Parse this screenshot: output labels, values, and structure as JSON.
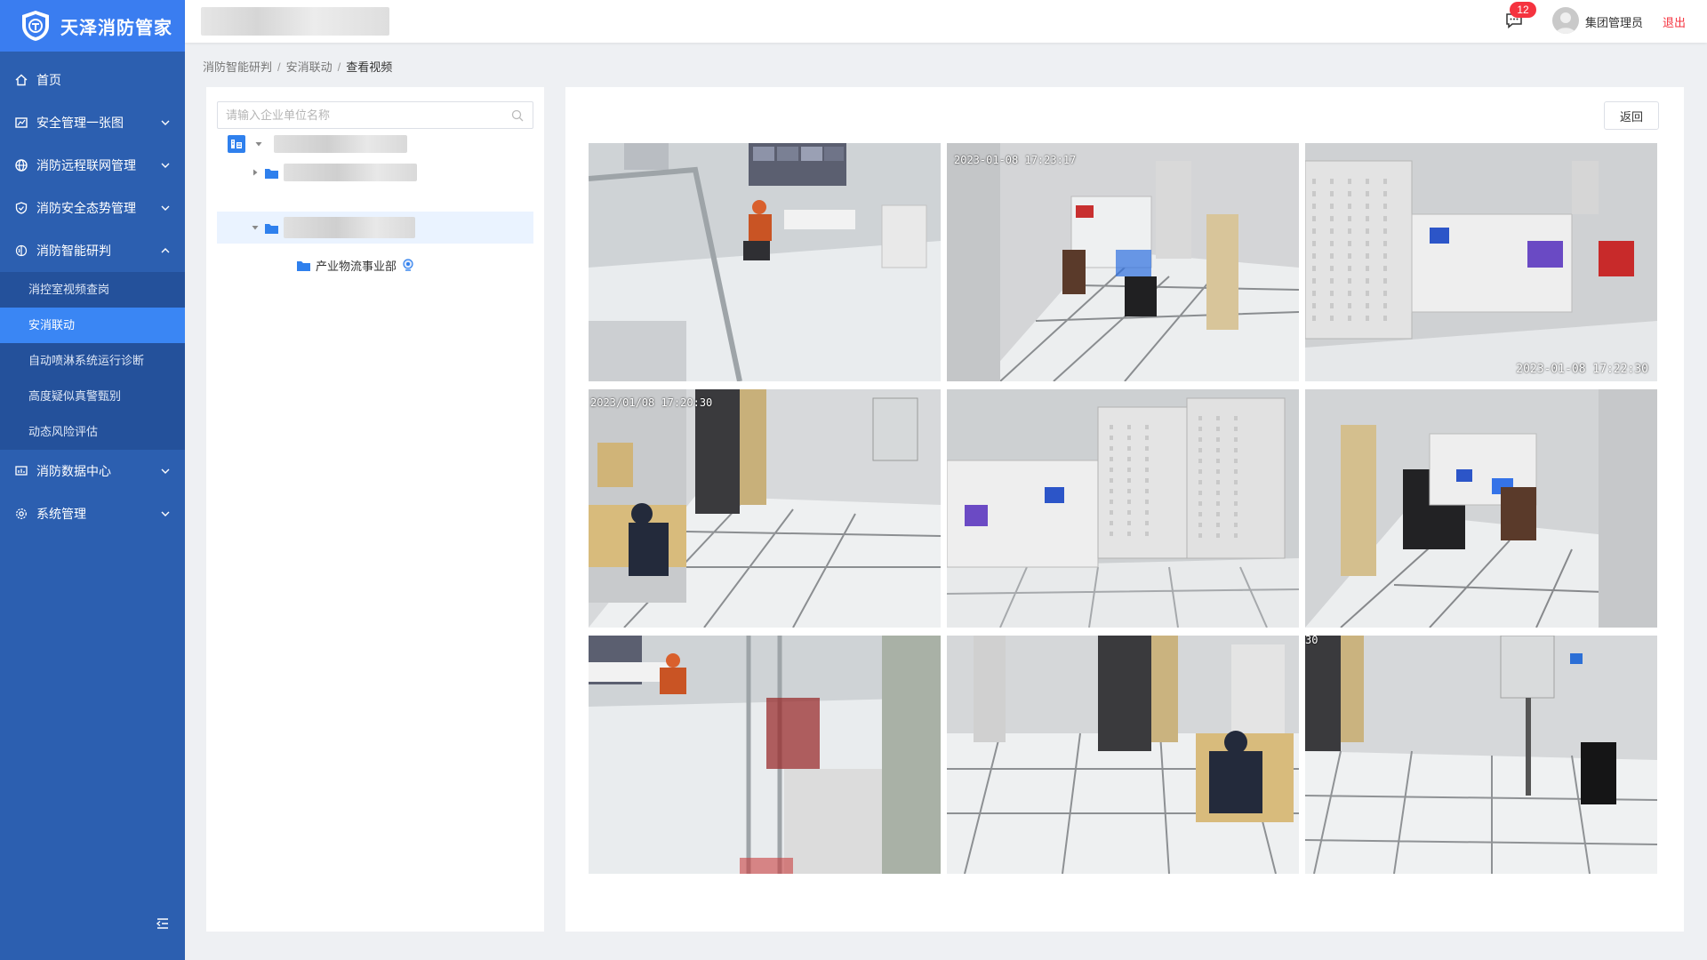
{
  "app": {
    "name": "天泽消防管家"
  },
  "header": {
    "badge_count": "12",
    "user_name": "集团管理员",
    "logout_label": "退出"
  },
  "sidebar": {
    "items": [
      {
        "label": "首页",
        "icon": "home-icon"
      },
      {
        "label": "安全管理一张图",
        "icon": "map-icon"
      },
      {
        "label": "消防远程联网管理",
        "icon": "globe-icon"
      },
      {
        "label": "消防安全态势管理",
        "icon": "shield-check-icon"
      },
      {
        "label": "消防智能研判",
        "icon": "brain-icon"
      },
      {
        "label": "消防数据中心",
        "icon": "data-icon"
      },
      {
        "label": "系统管理",
        "icon": "gear-icon"
      }
    ],
    "subitems": [
      {
        "label": "消控室视频查岗"
      },
      {
        "label": "安消联动"
      },
      {
        "label": "自动喷淋系统运行诊断"
      },
      {
        "label": "高度疑似真警甄别"
      },
      {
        "label": "动态风险评估"
      }
    ]
  },
  "breadcrumb": [
    "消防智能研判",
    "安消联动",
    "查看视频"
  ],
  "tree": {
    "search_placeholder": "请输入企业单位名称",
    "leaf_label": "产业物流事业部"
  },
  "video": {
    "back_label": "返回",
    "tiles": [
      {
        "timestamp": ""
      },
      {
        "timestamp": "2023-01-08 17:23:17"
      },
      {
        "timestamp": "2023-01-08 17:22:30"
      },
      {
        "timestamp": "2023/01/08 17:20:30"
      },
      {
        "timestamp": ""
      },
      {
        "timestamp": ""
      },
      {
        "timestamp": ""
      },
      {
        "timestamp": ""
      },
      {
        "timestamp": "30"
      }
    ]
  },
  "colors": {
    "sidebar": "#2c5fb0",
    "logo_bar": "#3a7df0",
    "active": "#3a86f4",
    "danger": "#f5333f"
  }
}
